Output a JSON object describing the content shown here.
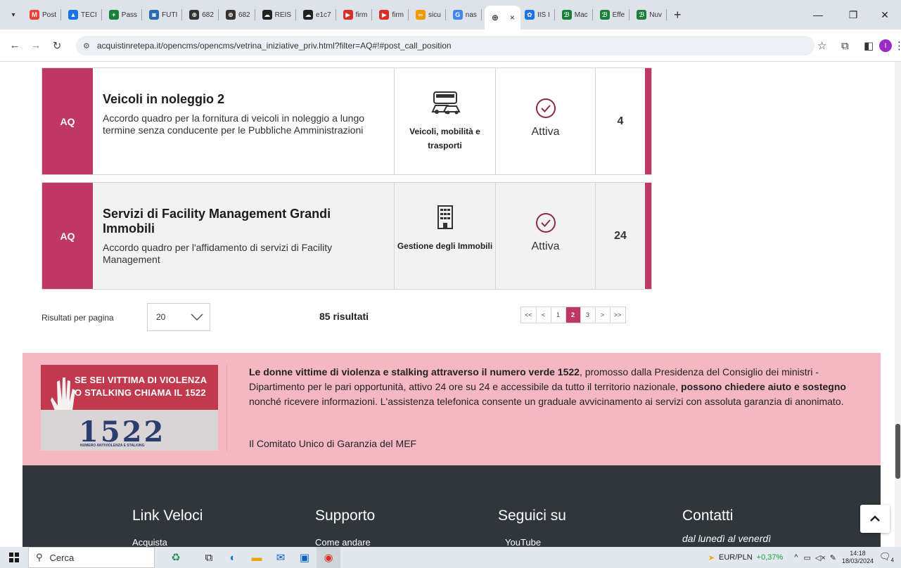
{
  "browser": {
    "tabs": [
      {
        "label": "Post",
        "fav": "M",
        "color": "#ea4335"
      },
      {
        "label": "TECI",
        "fav": "▲",
        "color": "#1a73e8"
      },
      {
        "label": "Pass",
        "fav": "+",
        "color": "#188038"
      },
      {
        "label": "FUTI",
        "fav": "◙",
        "color": "#2b6cb0"
      },
      {
        "label": "682",
        "fav": "⊕",
        "color": "#333333"
      },
      {
        "label": "682",
        "fav": "⊕",
        "color": "#333333"
      },
      {
        "label": "REIS",
        "fav": "☁",
        "color": "#222222"
      },
      {
        "label": "e1c7",
        "fav": "☁",
        "color": "#222222"
      },
      {
        "label": "firm",
        "fav": "▶",
        "color": "#d93025"
      },
      {
        "label": "firm",
        "fav": "▶",
        "color": "#d93025"
      },
      {
        "label": "sicu",
        "fav": "∞",
        "color": "#f29900"
      },
      {
        "label": "nas",
        "fav": "G",
        "color": "#4285f4"
      }
    ],
    "active_tab": {
      "close": "×"
    },
    "tabs_after": [
      {
        "label": "IIS I",
        "fav": "✿",
        "color": "#1a73e8"
      },
      {
        "label": "Mac",
        "fav": "ℬ",
        "color": "#188038"
      },
      {
        "label": "Effe",
        "fav": "ℬ",
        "color": "#188038"
      },
      {
        "label": "Nuv",
        "fav": "ℬ",
        "color": "#188038"
      }
    ],
    "new_tab": "+",
    "url": "acquistinretepa.it/opencms/opencms/vetrina_iniziative_priv.html?filter=AQ#!#post_call_position",
    "profile_initial": "I"
  },
  "cards": [
    {
      "type": "AQ",
      "title": "Veicoli in noleggio 2",
      "description": "Accordo quadro per la fornitura di veicoli in noleggio a lungo termine senza conducente per le Pubbliche Amministrazioni",
      "category": "Veicoli, mobilità e trasporti",
      "category_icon": "vehicles-icon",
      "status": "Attiva",
      "count": "4"
    },
    {
      "type": "AQ",
      "title": "Servizi di Facility Management Grandi Immobili",
      "description": "Accordo quadro per l'affidamento di servizi di Facility Management",
      "category": "Gestione degli Immobili",
      "category_icon": "building-icon",
      "status": "Attiva",
      "count": "24"
    }
  ],
  "pagination": {
    "rpp_label": "Risultati per pagina",
    "rpp_value": "20",
    "results": "85 risultati",
    "pages": [
      "<<",
      "<",
      "1",
      "2",
      "3",
      ">",
      ">>"
    ],
    "current": "2"
  },
  "banner": {
    "image_headline_1": "SE SEI VITTIMA DI VIOLENZA",
    "image_headline_2": "O STALKING CHIAMA IL 1522",
    "image_number": "1522",
    "image_small": "NUMERO ANTIVIOLENZA E STALKING",
    "text_bold_1": "Le donne vittime di violenza e stalking attraverso il numero verde 1522",
    "text_1": ", promosso dalla Presidenza del Consiglio dei ministri - Dipartimento per le pari opportunità, attivo 24 ore su 24 e accessibile da tutto il territorio nazionale, ",
    "text_bold_2": "possono chiedere aiuto e sostegno",
    "text_2": " nonché ricevere informazioni. L'assistenza telefonica consente un graduale avvicinamento ai servizi con assoluta garanzia di anonimato.",
    "link": "Il Comitato Unico di Garanzia del MEF"
  },
  "footer": {
    "col1": "Link Veloci",
    "col1_sub": "Acquista",
    "col2": "Supporto",
    "col2_sub": "Come andare",
    "col3": "Seguici su",
    "col3_sub": "YouTube",
    "col4": "Contatti",
    "col4_sub": "dal lunedì al venerdì"
  },
  "taskbar": {
    "search": "Cerca",
    "ticker_label": "EUR/PLN",
    "ticker_value": "+0,37%",
    "time": "14:18",
    "date": "18/03/2024",
    "notif_count": "4"
  },
  "colors": {
    "accent": "#bf3764",
    "banner_bg": "#f5b8c3",
    "footer_bg": "#30373b",
    "ticker_up": "#1a9e3a"
  }
}
